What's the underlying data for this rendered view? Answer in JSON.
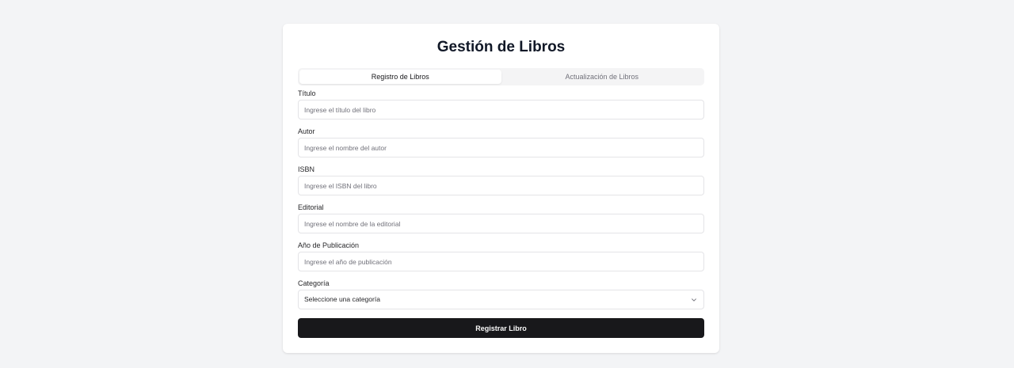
{
  "page": {
    "title": "Gestión de Libros"
  },
  "tabs": [
    {
      "label": "Registro de Libros",
      "active": true
    },
    {
      "label": "Actualización de Libros",
      "active": false
    }
  ],
  "form": {
    "fields": [
      {
        "label": "Título",
        "placeholder": "Ingrese el título del libro"
      },
      {
        "label": "Autor",
        "placeholder": "Ingrese el nombre del autor"
      },
      {
        "label": "ISBN",
        "placeholder": "Ingrese el ISBN del libro"
      },
      {
        "label": "Editorial",
        "placeholder": "Ingrese el nombre de la editorial"
      },
      {
        "label": "Año de Publicación",
        "placeholder": "Ingrese el año de publicación"
      }
    ],
    "category": {
      "label": "Categoría",
      "selected": "Seleccione una categoría"
    },
    "submit_label": "Registrar Libro"
  },
  "colors": {
    "background": "#f3f4f6",
    "card": "#ffffff",
    "primary_button": "#18181b"
  },
  "icons": {
    "select_chevron": "chevron-down-icon"
  }
}
